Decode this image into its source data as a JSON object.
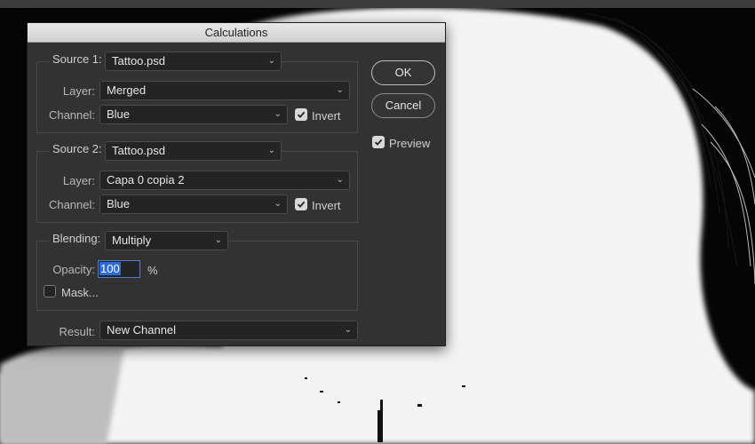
{
  "dialog": {
    "title": "Calculations",
    "source1": {
      "label": "Source 1:",
      "file": "Tattoo.psd",
      "layer_label": "Layer:",
      "layer": "Merged",
      "channel_label": "Channel:",
      "channel": "Blue",
      "invert_label": "Invert",
      "invert_checked": true
    },
    "source2": {
      "label": "Source 2:",
      "file": "Tattoo.psd",
      "layer_label": "Layer:",
      "layer": "Capa 0 copia 2",
      "channel_label": "Channel:",
      "channel": "Blue",
      "invert_label": "Invert",
      "invert_checked": true
    },
    "blending": {
      "label": "Blending:",
      "mode": "Multiply",
      "opacity_label": "Opacity:",
      "opacity": "100",
      "percent": "%",
      "mask_label": "Mask...",
      "mask_checked": false
    },
    "result": {
      "label": "Result:",
      "value": "New Channel"
    },
    "buttons": {
      "ok": "OK",
      "cancel": "Cancel"
    },
    "preview": {
      "label": "Preview",
      "checked": true
    }
  },
  "icons": {
    "chevron": "chevron-down-icon",
    "check": "checkmark-icon"
  }
}
